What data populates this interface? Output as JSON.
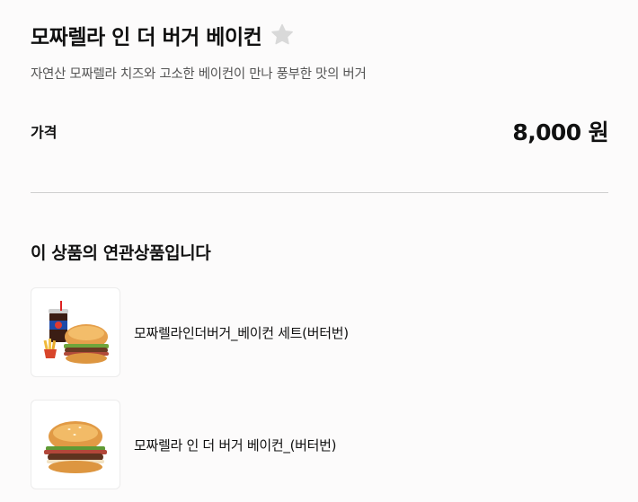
{
  "product": {
    "title": "모짜렐라 인 더 버거 베이컨",
    "description": "자연산 모짜렐라 치즈와 고소한 베이컨이 만나 풍부한 맛의 버거",
    "favorite_icon": "star-icon",
    "favorite_color": "#d9d9d9"
  },
  "price": {
    "label": "가격",
    "value": "8,000 원"
  },
  "related": {
    "title": "이 상품의 연관상품입니다",
    "items": [
      {
        "name": "모짜렐라인더버거_베이컨 세트(버터번)",
        "image": "burger-set-thumbnail"
      },
      {
        "name": "모짜렐라 인 더 버거 베이컨_(버터번)",
        "image": "burger-thumbnail"
      }
    ]
  }
}
